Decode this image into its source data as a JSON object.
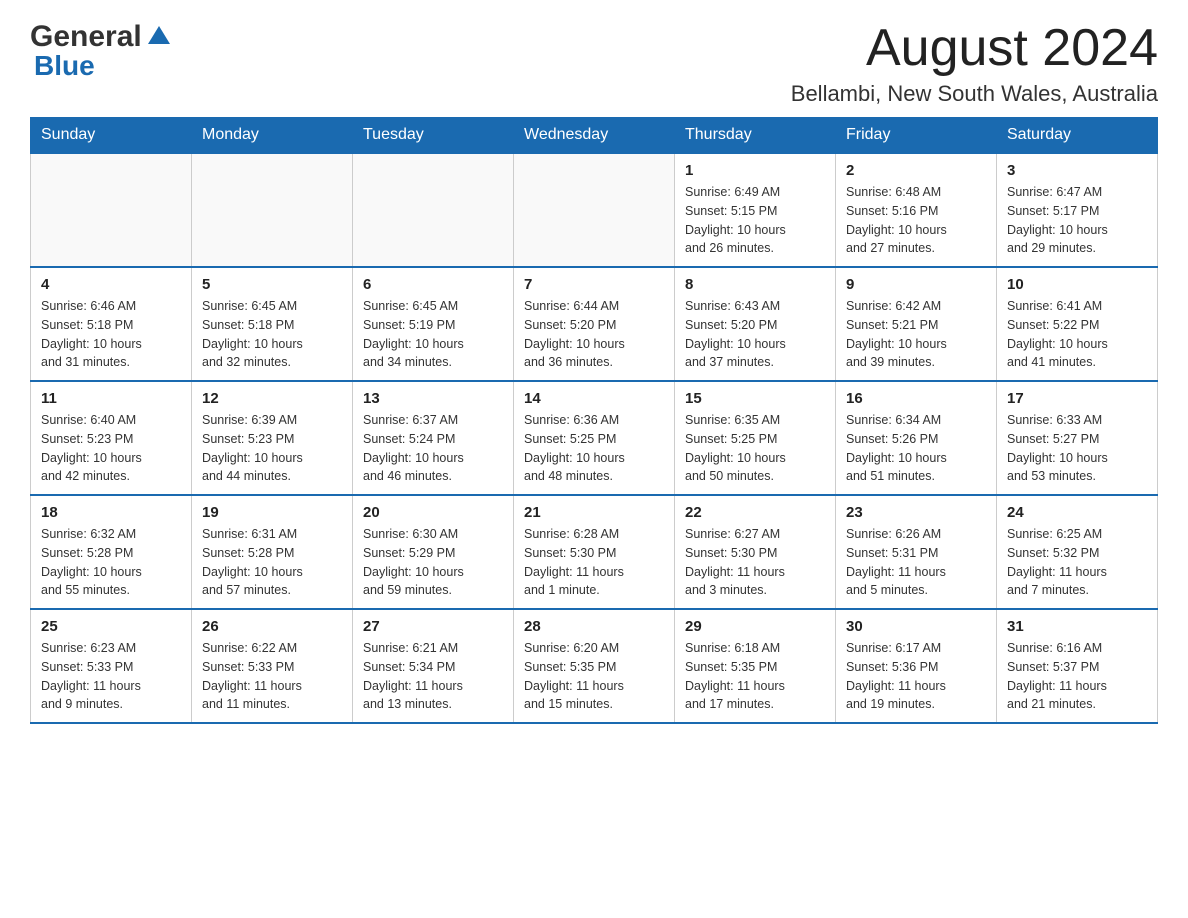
{
  "logo": {
    "general": "General",
    "blue": "Blue"
  },
  "header": {
    "month_year": "August 2024",
    "location": "Bellambi, New South Wales, Australia"
  },
  "days_of_week": [
    "Sunday",
    "Monday",
    "Tuesday",
    "Wednesday",
    "Thursday",
    "Friday",
    "Saturday"
  ],
  "weeks": [
    {
      "days": [
        {
          "number": "",
          "info": ""
        },
        {
          "number": "",
          "info": ""
        },
        {
          "number": "",
          "info": ""
        },
        {
          "number": "",
          "info": ""
        },
        {
          "number": "1",
          "info": "Sunrise: 6:49 AM\nSunset: 5:15 PM\nDaylight: 10 hours\nand 26 minutes."
        },
        {
          "number": "2",
          "info": "Sunrise: 6:48 AM\nSunset: 5:16 PM\nDaylight: 10 hours\nand 27 minutes."
        },
        {
          "number": "3",
          "info": "Sunrise: 6:47 AM\nSunset: 5:17 PM\nDaylight: 10 hours\nand 29 minutes."
        }
      ]
    },
    {
      "days": [
        {
          "number": "4",
          "info": "Sunrise: 6:46 AM\nSunset: 5:18 PM\nDaylight: 10 hours\nand 31 minutes."
        },
        {
          "number": "5",
          "info": "Sunrise: 6:45 AM\nSunset: 5:18 PM\nDaylight: 10 hours\nand 32 minutes."
        },
        {
          "number": "6",
          "info": "Sunrise: 6:45 AM\nSunset: 5:19 PM\nDaylight: 10 hours\nand 34 minutes."
        },
        {
          "number": "7",
          "info": "Sunrise: 6:44 AM\nSunset: 5:20 PM\nDaylight: 10 hours\nand 36 minutes."
        },
        {
          "number": "8",
          "info": "Sunrise: 6:43 AM\nSunset: 5:20 PM\nDaylight: 10 hours\nand 37 minutes."
        },
        {
          "number": "9",
          "info": "Sunrise: 6:42 AM\nSunset: 5:21 PM\nDaylight: 10 hours\nand 39 minutes."
        },
        {
          "number": "10",
          "info": "Sunrise: 6:41 AM\nSunset: 5:22 PM\nDaylight: 10 hours\nand 41 minutes."
        }
      ]
    },
    {
      "days": [
        {
          "number": "11",
          "info": "Sunrise: 6:40 AM\nSunset: 5:23 PM\nDaylight: 10 hours\nand 42 minutes."
        },
        {
          "number": "12",
          "info": "Sunrise: 6:39 AM\nSunset: 5:23 PM\nDaylight: 10 hours\nand 44 minutes."
        },
        {
          "number": "13",
          "info": "Sunrise: 6:37 AM\nSunset: 5:24 PM\nDaylight: 10 hours\nand 46 minutes."
        },
        {
          "number": "14",
          "info": "Sunrise: 6:36 AM\nSunset: 5:25 PM\nDaylight: 10 hours\nand 48 minutes."
        },
        {
          "number": "15",
          "info": "Sunrise: 6:35 AM\nSunset: 5:25 PM\nDaylight: 10 hours\nand 50 minutes."
        },
        {
          "number": "16",
          "info": "Sunrise: 6:34 AM\nSunset: 5:26 PM\nDaylight: 10 hours\nand 51 minutes."
        },
        {
          "number": "17",
          "info": "Sunrise: 6:33 AM\nSunset: 5:27 PM\nDaylight: 10 hours\nand 53 minutes."
        }
      ]
    },
    {
      "days": [
        {
          "number": "18",
          "info": "Sunrise: 6:32 AM\nSunset: 5:28 PM\nDaylight: 10 hours\nand 55 minutes."
        },
        {
          "number": "19",
          "info": "Sunrise: 6:31 AM\nSunset: 5:28 PM\nDaylight: 10 hours\nand 57 minutes."
        },
        {
          "number": "20",
          "info": "Sunrise: 6:30 AM\nSunset: 5:29 PM\nDaylight: 10 hours\nand 59 minutes."
        },
        {
          "number": "21",
          "info": "Sunrise: 6:28 AM\nSunset: 5:30 PM\nDaylight: 11 hours\nand 1 minute."
        },
        {
          "number": "22",
          "info": "Sunrise: 6:27 AM\nSunset: 5:30 PM\nDaylight: 11 hours\nand 3 minutes."
        },
        {
          "number": "23",
          "info": "Sunrise: 6:26 AM\nSunset: 5:31 PM\nDaylight: 11 hours\nand 5 minutes."
        },
        {
          "number": "24",
          "info": "Sunrise: 6:25 AM\nSunset: 5:32 PM\nDaylight: 11 hours\nand 7 minutes."
        }
      ]
    },
    {
      "days": [
        {
          "number": "25",
          "info": "Sunrise: 6:23 AM\nSunset: 5:33 PM\nDaylight: 11 hours\nand 9 minutes."
        },
        {
          "number": "26",
          "info": "Sunrise: 6:22 AM\nSunset: 5:33 PM\nDaylight: 11 hours\nand 11 minutes."
        },
        {
          "number": "27",
          "info": "Sunrise: 6:21 AM\nSunset: 5:34 PM\nDaylight: 11 hours\nand 13 minutes."
        },
        {
          "number": "28",
          "info": "Sunrise: 6:20 AM\nSunset: 5:35 PM\nDaylight: 11 hours\nand 15 minutes."
        },
        {
          "number": "29",
          "info": "Sunrise: 6:18 AM\nSunset: 5:35 PM\nDaylight: 11 hours\nand 17 minutes."
        },
        {
          "number": "30",
          "info": "Sunrise: 6:17 AM\nSunset: 5:36 PM\nDaylight: 11 hours\nand 19 minutes."
        },
        {
          "number": "31",
          "info": "Sunrise: 6:16 AM\nSunset: 5:37 PM\nDaylight: 11 hours\nand 21 minutes."
        }
      ]
    }
  ]
}
